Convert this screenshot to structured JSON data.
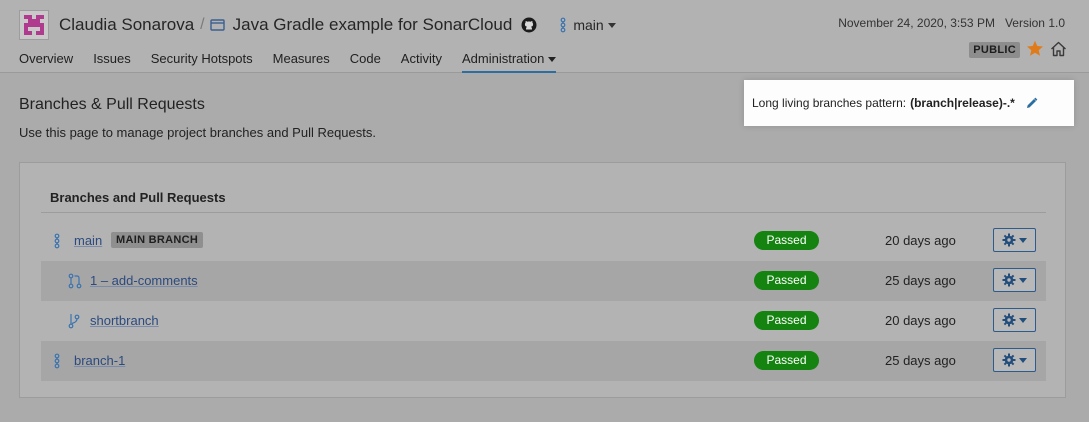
{
  "header": {
    "org_name": "Claudia Sonarova",
    "separator": "/",
    "project_name": "Java Gradle example for SonarCloud",
    "branch_label": "main",
    "analysis_date": "November 24, 2020, 3:53 PM",
    "version": "Version 1.0",
    "visibility_badge": "PUBLIC"
  },
  "tabs": [
    {
      "label": "Overview"
    },
    {
      "label": "Issues"
    },
    {
      "label": "Security Hotspots"
    },
    {
      "label": "Measures"
    },
    {
      "label": "Code"
    },
    {
      "label": "Activity"
    },
    {
      "label": "Administration",
      "active": true
    }
  ],
  "page": {
    "title": "Branches & Pull Requests",
    "description": "Use this page to manage project branches and Pull Requests.",
    "pattern_label": "Long living branches pattern:",
    "pattern_value": "(branch|release)-.*"
  },
  "card": {
    "title": "Branches and Pull Requests",
    "rows": [
      {
        "name": "main",
        "badge": "MAIN BRANCH",
        "status": "Passed",
        "age": "20 days ago",
        "icon": "long-branch-icon"
      },
      {
        "name": "1 – add-comments",
        "status": "Passed",
        "age": "25 days ago",
        "icon": "pull-request-icon"
      },
      {
        "name": "shortbranch",
        "status": "Passed",
        "age": "20 days ago",
        "icon": "short-branch-icon"
      },
      {
        "name": "branch-1",
        "status": "Passed",
        "age": "25 days ago",
        "icon": "long-branch-icon"
      }
    ]
  },
  "colors": {
    "accent": "#2d6ea1",
    "status_passed": "#14830f",
    "favorite_star": "#e07b1a",
    "link": "#2c4a7e"
  },
  "icons": {
    "org_avatar": "pink-pixel-avatar",
    "project": "project-icon",
    "repo": "github-icon",
    "favorite": "star-icon",
    "home": "home-icon",
    "edit": "pencil-icon",
    "row_actions": "gear-icon"
  }
}
